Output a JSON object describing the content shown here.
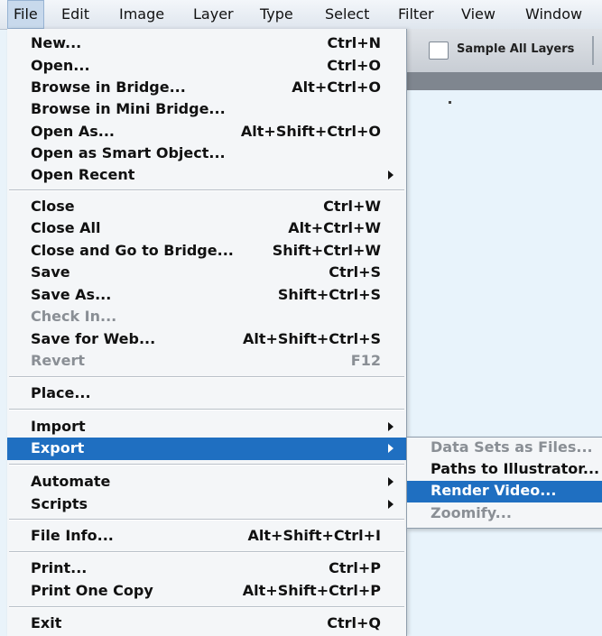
{
  "menubar": {
    "items": [
      "File",
      "Edit",
      "Image",
      "Layer",
      "Type",
      "Select",
      "Filter",
      "View",
      "Window"
    ],
    "active": "File"
  },
  "options_bar": {
    "sample_all_layers_label": "Sample All Layers",
    "sample_all_layers_checked": false
  },
  "file_menu": {
    "items": [
      {
        "label": "New...",
        "shortcut": "Ctrl+N"
      },
      {
        "label": "Open...",
        "shortcut": "Ctrl+O"
      },
      {
        "label": "Browse in Bridge...",
        "shortcut": "Alt+Ctrl+O"
      },
      {
        "label": "Browse in Mini Bridge...",
        "shortcut": ""
      },
      {
        "label": "Open As...",
        "shortcut": "Alt+Shift+Ctrl+O"
      },
      {
        "label": "Open as Smart Object...",
        "shortcut": ""
      },
      {
        "label": "Open Recent",
        "shortcut": ""
      },
      {
        "label": "Close",
        "shortcut": "Ctrl+W"
      },
      {
        "label": "Close All",
        "shortcut": "Alt+Ctrl+W"
      },
      {
        "label": "Close and Go to Bridge...",
        "shortcut": "Shift+Ctrl+W"
      },
      {
        "label": "Save",
        "shortcut": "Ctrl+S"
      },
      {
        "label": "Save As...",
        "shortcut": "Shift+Ctrl+S"
      },
      {
        "label": "Check In...",
        "shortcut": ""
      },
      {
        "label": "Save for Web...",
        "shortcut": "Alt+Shift+Ctrl+S"
      },
      {
        "label": "Revert",
        "shortcut": "F12"
      },
      {
        "label": "Place...",
        "shortcut": ""
      },
      {
        "label": "Import",
        "shortcut": ""
      },
      {
        "label": "Export",
        "shortcut": ""
      },
      {
        "label": "Automate",
        "shortcut": ""
      },
      {
        "label": "Scripts",
        "shortcut": ""
      },
      {
        "label": "File Info...",
        "shortcut": "Alt+Shift+Ctrl+I"
      },
      {
        "label": "Print...",
        "shortcut": "Ctrl+P"
      },
      {
        "label": "Print One Copy",
        "shortcut": "Alt+Shift+Ctrl+P"
      },
      {
        "label": "Exit",
        "shortcut": "Ctrl+Q"
      }
    ],
    "disabled": [
      "Check In...",
      "Revert"
    ],
    "highlighted": "Export",
    "with_submenu": [
      "Open Recent",
      "Import",
      "Export",
      "Automate",
      "Scripts"
    ]
  },
  "export_submenu": {
    "items": [
      {
        "label": "Data Sets as Files...",
        "enabled": false
      },
      {
        "label": "Paths to Illustrator...",
        "enabled": true
      },
      {
        "label": "Render Video...",
        "enabled": true
      },
      {
        "label": "Zoomify...",
        "enabled": false
      }
    ],
    "highlighted": "Render Video..."
  },
  "colors": {
    "highlight": "#1f6fc1",
    "menu_background": "#f4f6f8",
    "disabled_text": "#8a8f95",
    "canvas": "#e8f3fb"
  }
}
